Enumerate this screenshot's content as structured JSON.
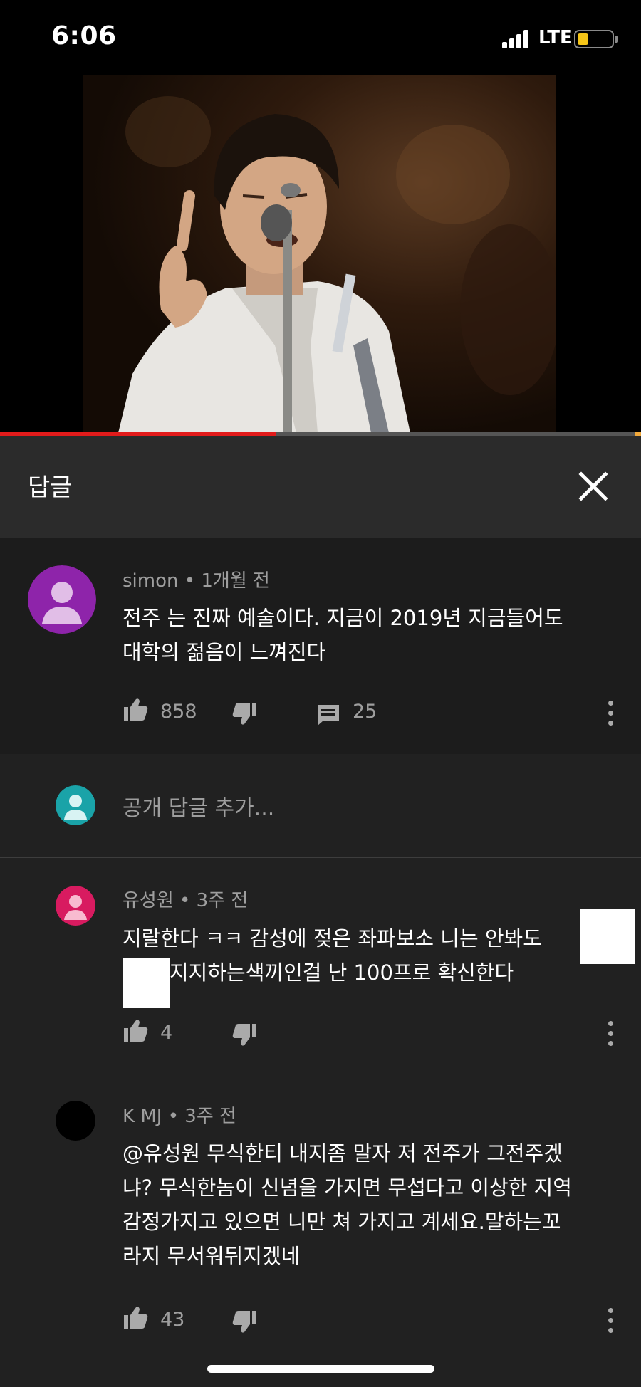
{
  "status_bar": {
    "time": "6:06",
    "network": "LTE"
  },
  "video": {
    "progress_fraction": 0.43
  },
  "panel": {
    "title": "답글",
    "close_icon": "close-icon"
  },
  "parent_comment": {
    "author": "simon",
    "separator": "•",
    "time": "1개월 전",
    "text_line1": "전주 는 진짜 예술이다. 지금이 2019년 지금들어도",
    "text_line2": "대학의 젊음이 느껴진다",
    "likes": "858",
    "replies": "25",
    "avatar_color": "#8e24aa"
  },
  "reply_input": {
    "placeholder": "공개 답글 추가...",
    "avatar_color": "#1aa3a8"
  },
  "replies": [
    {
      "author": "유성원",
      "separator": "•",
      "time": "3주 전",
      "text_line1": "지랄한다 ㅋㅋ 감성에 젖은 좌파보소 니는 안봐도",
      "text_line2": "지지하는색끼인걸 난 100프로 확신한다",
      "likes": "4",
      "avatar_color": "#d81b60"
    },
    {
      "author": "K MJ",
      "separator": "•",
      "time": "3주 전",
      "text_line1": "@유성원 무식한티 내지좀 말자 저 전주가 그전주겠",
      "text_line2": "냐? 무식한놈이 신념을 가지면 무섭다고 이상한 지역",
      "text_line3": "감정가지고 있으면 니만 쳐 가지고 계세요.말하는꼬",
      "text_line4": "라지 무서워뒤지겠네",
      "likes": "43",
      "avatar_color": "#000000"
    }
  ],
  "colors": {
    "accent_red": "#e21b1b",
    "panel_bg": "#212121",
    "header_bg": "#2b2b2b"
  }
}
